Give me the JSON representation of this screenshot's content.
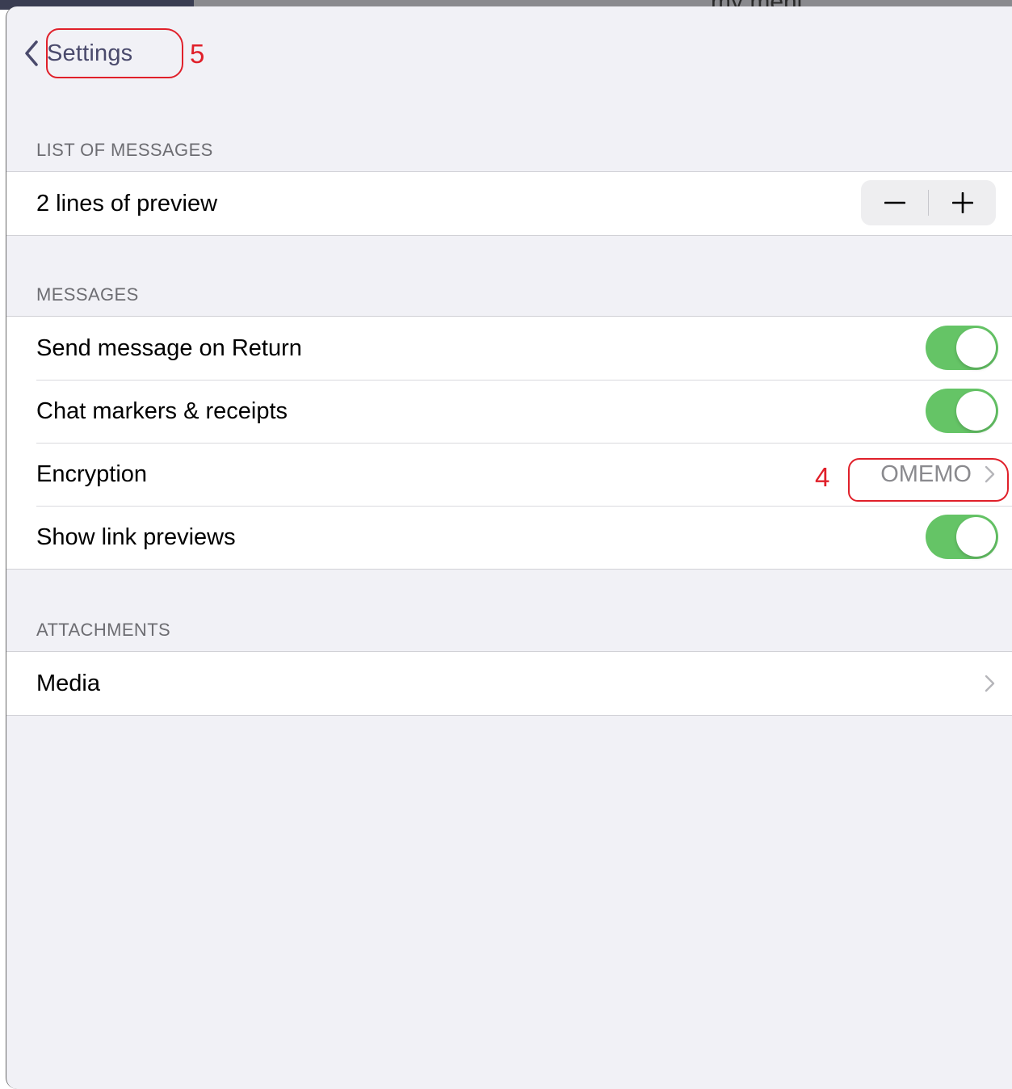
{
  "backdrop": {
    "peek_text": "my meni"
  },
  "navbar": {
    "back_label": "Settings",
    "back_icon": "chevron-left-icon"
  },
  "annotations": [
    {
      "number": "5",
      "color": "#e0202a",
      "target": "back-button"
    },
    {
      "number": "4",
      "color": "#e0202a",
      "target": "encryption-value"
    }
  ],
  "sections": {
    "list_of_messages": {
      "header": "LIST OF MESSAGES",
      "preview_lines": {
        "label": "2 lines of preview",
        "minus": "−",
        "plus": "+"
      }
    },
    "messages": {
      "header": "MESSAGES",
      "send_on_return": {
        "label": "Send message on Return",
        "on": true
      },
      "chat_markers": {
        "label": "Chat markers & receipts",
        "on": true
      },
      "encryption": {
        "label": "Encryption",
        "value": "OMEMO"
      },
      "link_previews": {
        "label": "Show link previews",
        "on": true
      }
    },
    "attachments": {
      "header": "ATTACHMENTS",
      "media": {
        "label": "Media"
      }
    }
  },
  "colors": {
    "accent": "#4a4a6c",
    "toggle_on": "#65c466",
    "background": "#f1f1f6",
    "annotation": "#e0202a"
  }
}
